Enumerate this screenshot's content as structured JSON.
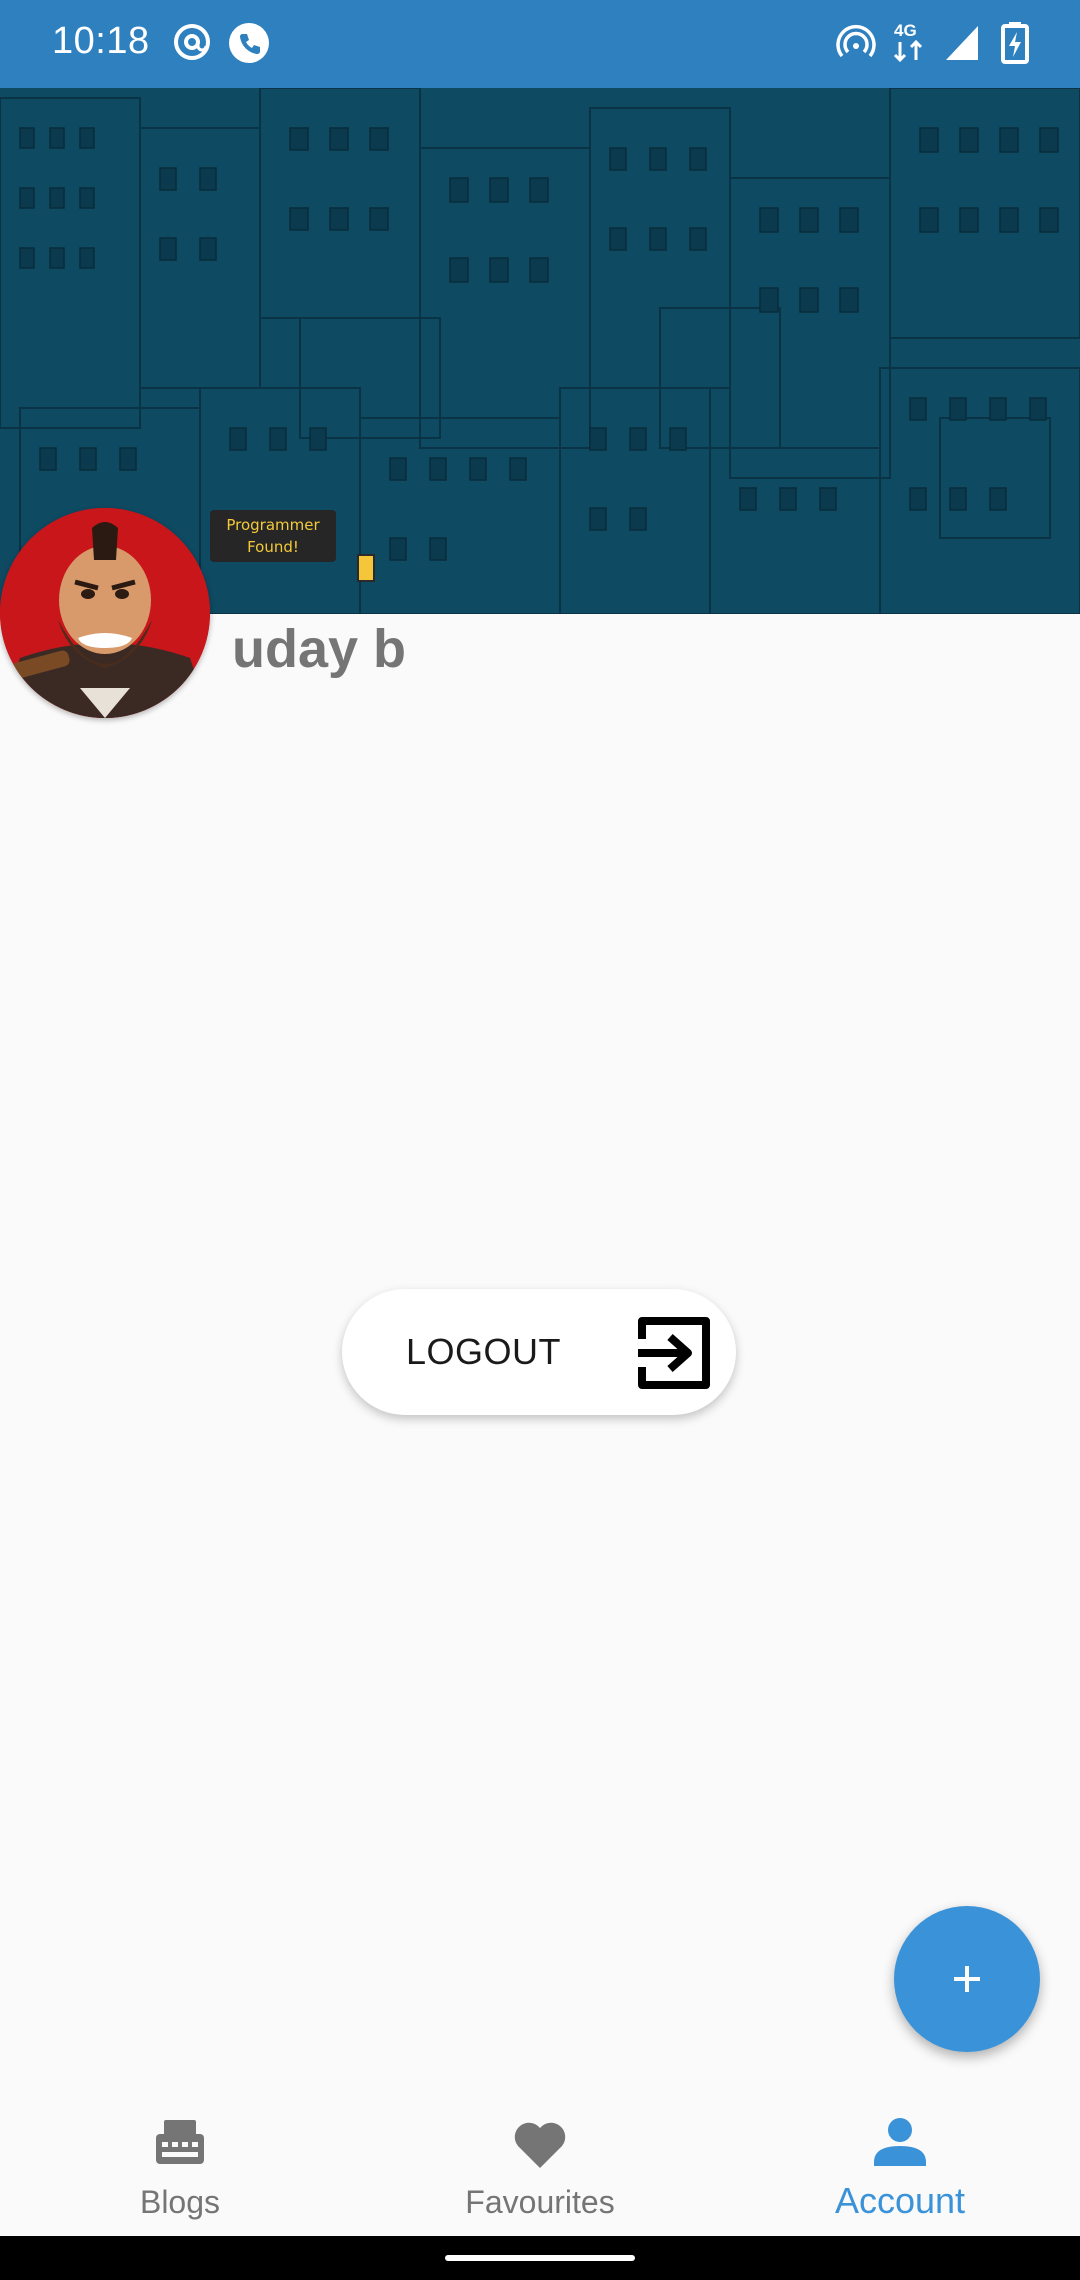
{
  "status_bar": {
    "time": "10:18",
    "network": "4G",
    "left_icons": [
      "at-sign-icon",
      "phone-icon"
    ],
    "right_icons": [
      "hotspot-icon",
      "network-4g-icon",
      "signal-icon",
      "battery-charging-icon"
    ]
  },
  "cover": {
    "tooltip_line1": "Programmer",
    "tooltip_line2": "Found!"
  },
  "profile": {
    "name": "uday b"
  },
  "logout_button": {
    "label": "LOGOUT",
    "icon": "exit-to-app-icon"
  },
  "fab": {
    "icon": "plus-icon"
  },
  "bottom_nav": {
    "items": [
      {
        "label": "Blogs",
        "icon": "blogs-icon",
        "active": false
      },
      {
        "label": "Favourites",
        "icon": "heart-icon",
        "active": false
      },
      {
        "label": "Account",
        "icon": "person-icon",
        "active": true
      }
    ]
  },
  "colors": {
    "status_bar": "#2f80bf",
    "accent": "#3a92d8",
    "cover_background": "#0f4a63",
    "inactive_label": "#757575"
  }
}
